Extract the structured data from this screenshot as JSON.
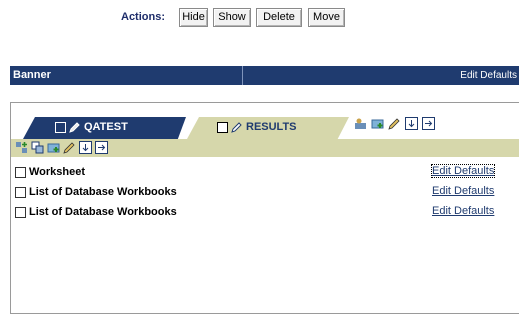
{
  "actions": {
    "label": "Actions:",
    "buttons": {
      "hide": "Hide",
      "show": "Show",
      "delete": "Delete",
      "move": "Move"
    }
  },
  "banner": {
    "title": "Banner",
    "edit": "Edit Defaults"
  },
  "tabs": [
    {
      "label": "QATEST",
      "active": true
    },
    {
      "label": "RESULTS",
      "active": false
    }
  ],
  "rows": [
    {
      "title": "Worksheet",
      "edit": "Edit Defaults"
    },
    {
      "title": "List of Database Workbooks",
      "edit": "Edit Defaults"
    },
    {
      "title": "List of Database Workbooks",
      "edit": "Edit Defaults"
    }
  ],
  "colors": {
    "navy": "#1f3b6f",
    "khaki": "#d6d7ab"
  }
}
